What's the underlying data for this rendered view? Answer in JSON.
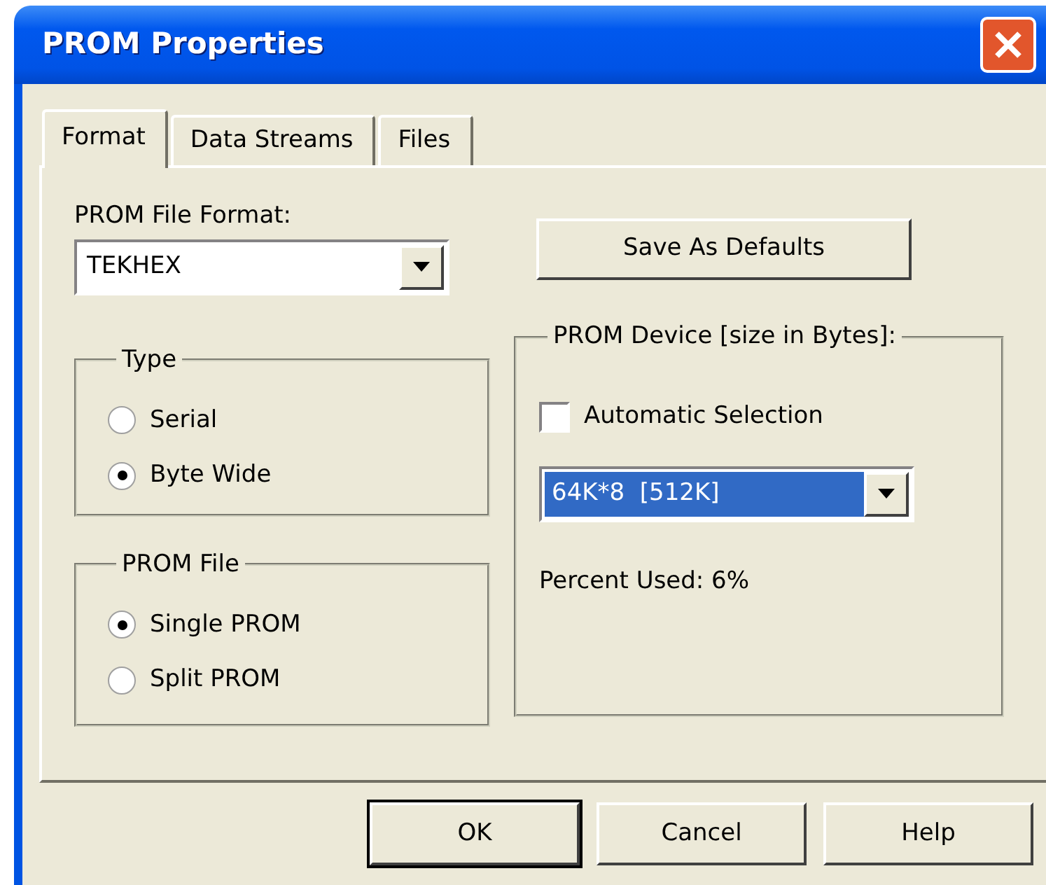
{
  "window": {
    "title": "PROM Properties"
  },
  "tabs": [
    {
      "label": "Format",
      "selected": true
    },
    {
      "label": "Data Streams",
      "selected": false
    },
    {
      "label": "Files",
      "selected": false
    }
  ],
  "file_format": {
    "label": "PROM File Format:",
    "value": "TEKHEX"
  },
  "save_defaults_button": "Save As Defaults",
  "type_group": {
    "label": "Type",
    "options": [
      {
        "label": "Serial",
        "selected": false
      },
      {
        "label": "Byte Wide",
        "selected": true
      }
    ]
  },
  "prom_file_group": {
    "label": "PROM File",
    "options": [
      {
        "label": "Single PROM",
        "selected": true
      },
      {
        "label": "Split PROM",
        "selected": false
      }
    ]
  },
  "device_group": {
    "label": "PROM Device [size in Bytes]:",
    "automatic_selection": {
      "label": "Automatic Selection",
      "checked": false
    },
    "device": {
      "value": "64K*8  [512K]",
      "highlighted": true
    },
    "percent_used": "Percent Used: 6%"
  },
  "buttons": [
    {
      "label": "OK",
      "default": true
    },
    {
      "label": "Cancel",
      "default": false
    },
    {
      "label": "Help",
      "default": false
    }
  ]
}
